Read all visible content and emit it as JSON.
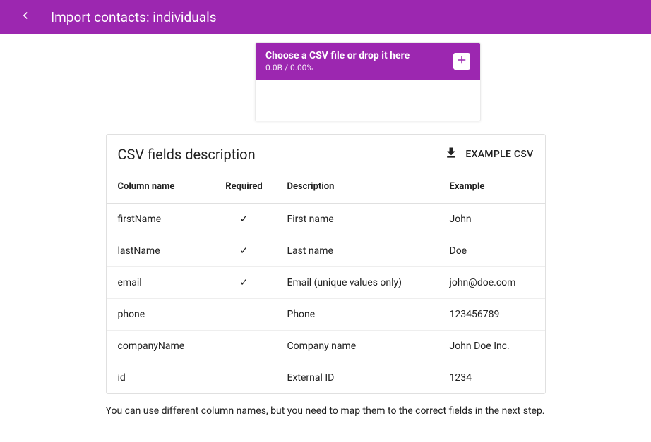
{
  "header": {
    "title": "Import contacts: individuals"
  },
  "upload": {
    "title": "Choose a CSV file or drop it here",
    "progress": "0.0B / 0.00%"
  },
  "fields": {
    "title": "CSV fields description",
    "exampleLabel": "EXAMPLE CSV",
    "headers": {
      "column": "Column name",
      "required": "Required",
      "description": "Description",
      "example": "Example"
    },
    "rows": [
      {
        "column": "firstName",
        "required": "✓",
        "description": "First name",
        "example": "John"
      },
      {
        "column": "lastName",
        "required": "✓",
        "description": "Last name",
        "example": "Doe"
      },
      {
        "column": "email",
        "required": "✓",
        "description": "Email (unique values only)",
        "example": "john@doe.com"
      },
      {
        "column": "phone",
        "required": "",
        "description": "Phone",
        "example": "123456789"
      },
      {
        "column": "companyName",
        "required": "",
        "description": "Company name",
        "example": "John Doe Inc."
      },
      {
        "column": "id",
        "required": "",
        "description": "External ID",
        "example": "1234"
      }
    ]
  },
  "footnote": "You can use different column names, but you need to map them to the correct fields in the next step."
}
